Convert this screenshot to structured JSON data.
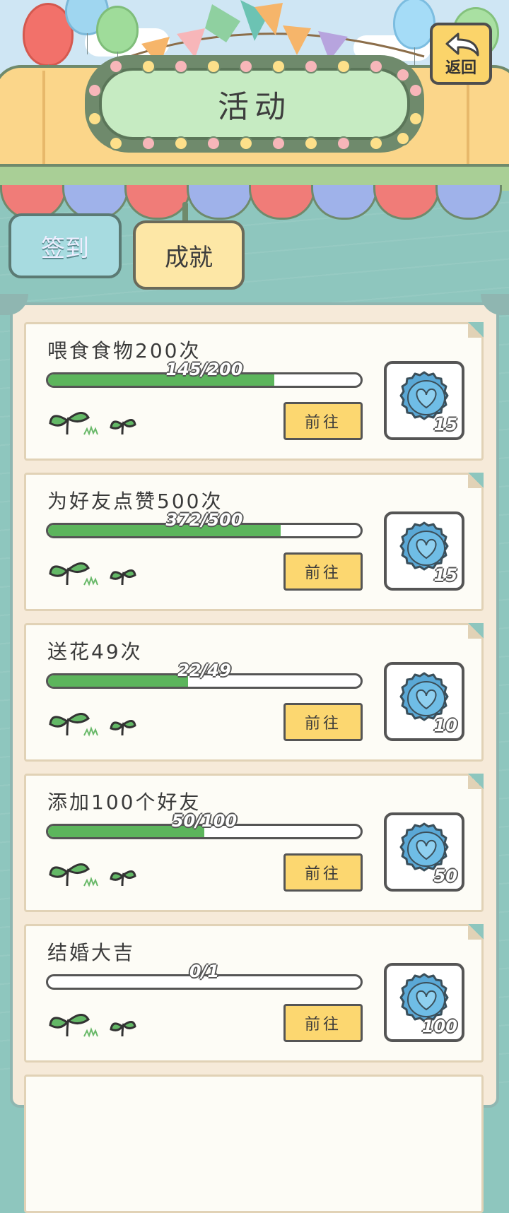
{
  "header": {
    "title": "活动",
    "back_label": "返回"
  },
  "tabs": [
    {
      "label": "签到",
      "active": false
    },
    {
      "label": "成就",
      "active": true
    }
  ],
  "achievements": [
    {
      "title": "喂食食物200次",
      "progress_text": "145/200",
      "current": 145,
      "target": 200,
      "button": "前往",
      "reward_count": "15",
      "reward_icon": "bottle-cap-icon"
    },
    {
      "title": "为好友点赞500次",
      "progress_text": "372/500",
      "current": 372,
      "target": 500,
      "button": "前往",
      "reward_count": "15",
      "reward_icon": "bottle-cap-icon"
    },
    {
      "title": "送花49次",
      "progress_text": "22/49",
      "current": 22,
      "target": 49,
      "button": "前往",
      "reward_count": "10",
      "reward_icon": "bottle-cap-icon"
    },
    {
      "title": "添加100个好友",
      "progress_text": "50/100",
      "current": 50,
      "target": 100,
      "button": "前往",
      "reward_count": "50",
      "reward_icon": "bottle-cap-icon"
    },
    {
      "title": "结婚大吉",
      "progress_text": "0/1",
      "current": 0,
      "target": 1,
      "button": "前往",
      "reward_count": "100",
      "reward_icon": "bottle-cap-icon"
    }
  ],
  "colors": {
    "progress_fill": "#5cb55c",
    "button_bg": "#fcd770",
    "reward_coin": "#5aa8d6"
  }
}
